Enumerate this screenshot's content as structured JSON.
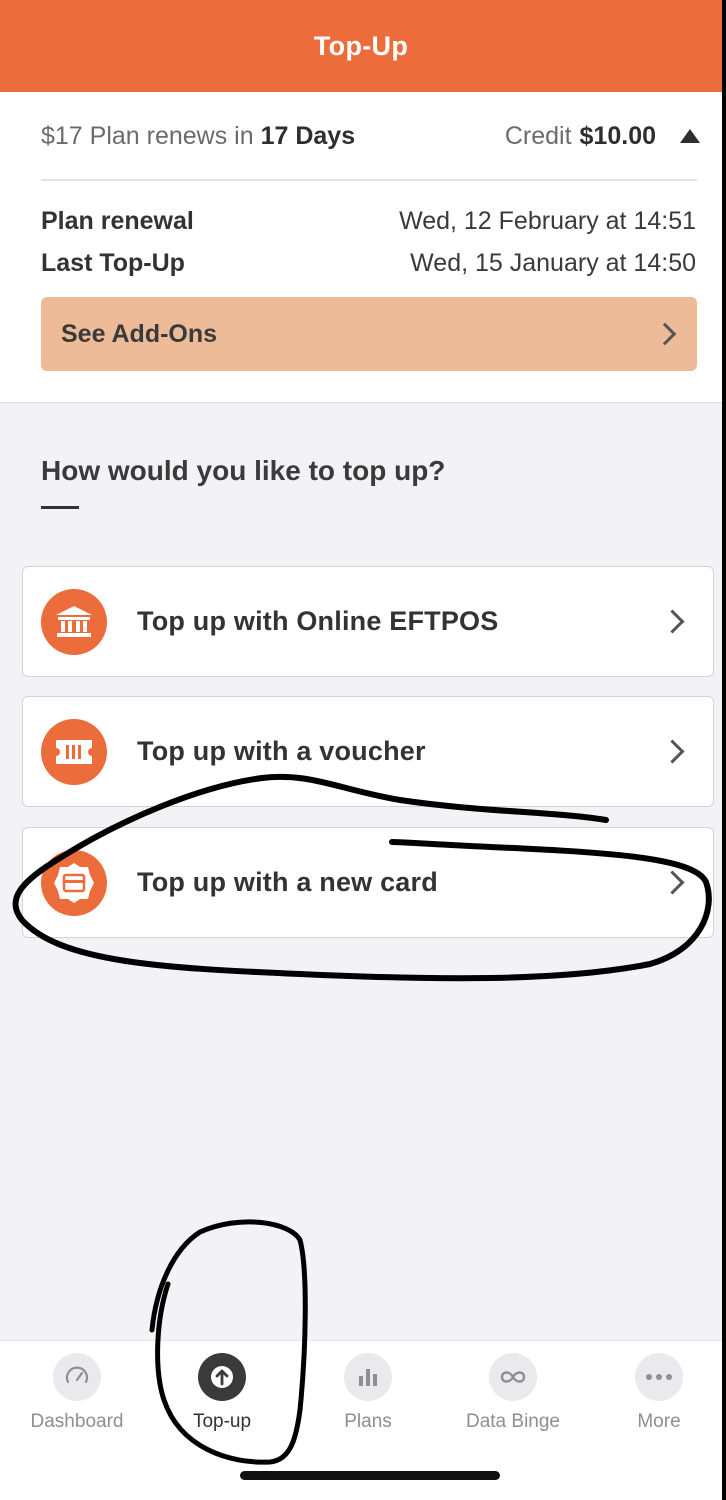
{
  "header": {
    "title": "Top-Up"
  },
  "summary": {
    "plan_prefix": "$17 Plan renews in",
    "plan_days": "17 Days",
    "credit_label": "Credit",
    "credit_value": "$10.00",
    "plan_renewal_label": "Plan renewal",
    "plan_renewal_value": "Wed, 12 February at 14:51",
    "last_topup_label": "Last Top-Up",
    "last_topup_value": "Wed, 15 January at 14:50",
    "addons_label": "See Add-Ons"
  },
  "question": "How would you like to top up?",
  "options": [
    {
      "label": "Top up with Online EFTPOS",
      "icon": "bank-icon"
    },
    {
      "label": "Top up with a voucher",
      "icon": "voucher-icon"
    },
    {
      "label": "Top up with a new card",
      "icon": "card-icon"
    }
  ],
  "tabs": [
    {
      "label": "Dashboard",
      "icon": "speedometer-icon",
      "active": false
    },
    {
      "label": "Top-up",
      "icon": "arrow-up-circle-icon",
      "active": true
    },
    {
      "label": "Plans",
      "icon": "bar-chart-icon",
      "active": false
    },
    {
      "label": "Data Binge",
      "icon": "infinity-icon",
      "active": false
    },
    {
      "label": "More",
      "icon": "more-dots-icon",
      "active": false
    }
  ],
  "colors": {
    "brand": "#ec6d3b",
    "addons_bg": "#edbb98",
    "ink": "#000000"
  }
}
